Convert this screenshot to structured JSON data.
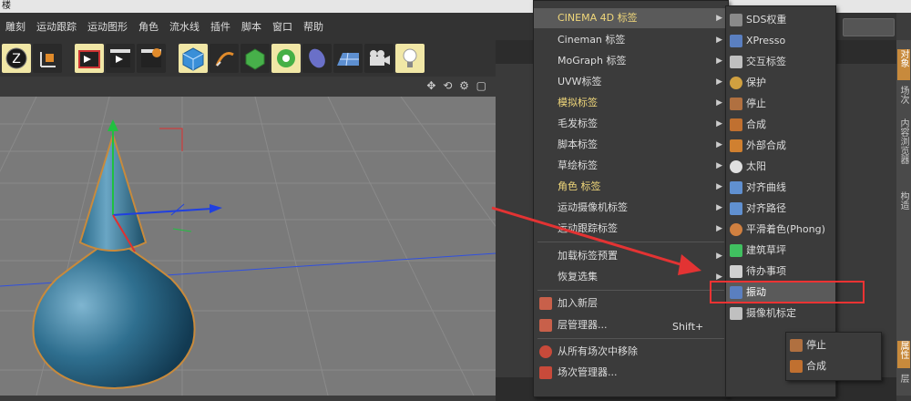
{
  "window": {
    "title": "楼"
  },
  "menubar": {
    "items": [
      "雕刻",
      "运动跟踪",
      "运动图形",
      "角色",
      "流水线",
      "插件",
      "脚本",
      "窗口",
      "帮助"
    ]
  },
  "side_tabs": {
    "active": "属性",
    "items": [
      "对象",
      "场次",
      "内容浏览器",
      "构造",
      "属性",
      "层"
    ]
  },
  "main_menu": {
    "items": [
      {
        "label": "CINEMA 4D 标签",
        "arrow": "▶",
        "highlight": true,
        "gold": true
      },
      {
        "label": "Cineman 标签",
        "arrow": "▶"
      },
      {
        "label": "MoGraph 标签",
        "arrow": "▶"
      },
      {
        "label": "UVW标签",
        "arrow": "▶"
      },
      {
        "label": "模拟标签",
        "arrow": "▶",
        "gold": true
      },
      {
        "label": "毛发标签",
        "arrow": "▶"
      },
      {
        "label": "脚本标签",
        "arrow": "▶"
      },
      {
        "label": "草绘标签",
        "arrow": "▶"
      },
      {
        "label": "角色 标签",
        "arrow": "▶",
        "gold": true
      },
      {
        "label": "运动摄像机标签",
        "arrow": "▶"
      },
      {
        "label": "运动跟踪标签",
        "arrow": "▶"
      }
    ],
    "items2": [
      {
        "label": "加载标签预置",
        "arrow": "▶"
      },
      {
        "label": "恢复选集",
        "arrow": "▶"
      }
    ],
    "items3": [
      {
        "label": "加入新层"
      },
      {
        "label": "层管理器..."
      }
    ],
    "items4": [
      {
        "label": "从所有场次中移除"
      },
      {
        "label": "场次管理器..."
      }
    ],
    "hotkey": "Shift+"
  },
  "tag_submenu": {
    "items": [
      {
        "label": "SDS权重",
        "icon": "sds-weight-icon",
        "color": "#8a8a8a"
      },
      {
        "label": "XPresso",
        "icon": "xpresso-icon",
        "color": "#5a7fc0"
      },
      {
        "label": "交互标签",
        "icon": "interaction-tag-icon",
        "color": "#c0c0c0"
      },
      {
        "label": "保护",
        "icon": "protection-icon",
        "color": "#d0a040"
      },
      {
        "label": "停止",
        "icon": "stop-icon",
        "color": "#b07040"
      },
      {
        "label": "合成",
        "icon": "compositing-icon",
        "color": "#c07030"
      },
      {
        "label": "外部合成",
        "icon": "external-compositing-icon",
        "color": "#d08030"
      },
      {
        "label": "太阳",
        "icon": "sun-icon",
        "color": "#e0e0e0"
      },
      {
        "label": "对齐曲线",
        "icon": "align-spline-icon",
        "color": "#6090d0"
      },
      {
        "label": "对齐路径",
        "icon": "align-path-icon",
        "color": "#6090d0"
      },
      {
        "label": "平滑着色(Phong)",
        "icon": "phong-icon",
        "color": "#d08040"
      },
      {
        "label": "建筑草坪",
        "icon": "grass-icon",
        "color": "#40c060"
      },
      {
        "label": "待办事项",
        "icon": "todo-icon",
        "color": "#d0d0d0"
      },
      {
        "label": "振动",
        "icon": "vibrate-icon",
        "color": "#5a7fc0",
        "highlight": true
      },
      {
        "label": "摄像机标定",
        "icon": "camera-calibrate-icon",
        "color": "#c0c0c0"
      }
    ]
  },
  "sim_submenu": {
    "items": [
      {
        "label": "停止",
        "icon": "stop-icon"
      },
      {
        "label": "合成",
        "icon": "compositing-icon"
      }
    ]
  },
  "colors": {
    "menu_bg": "#3b3b3b",
    "highlight": "#5a5a5a",
    "annotation": "#e33333",
    "gold": "#f0d77a"
  }
}
